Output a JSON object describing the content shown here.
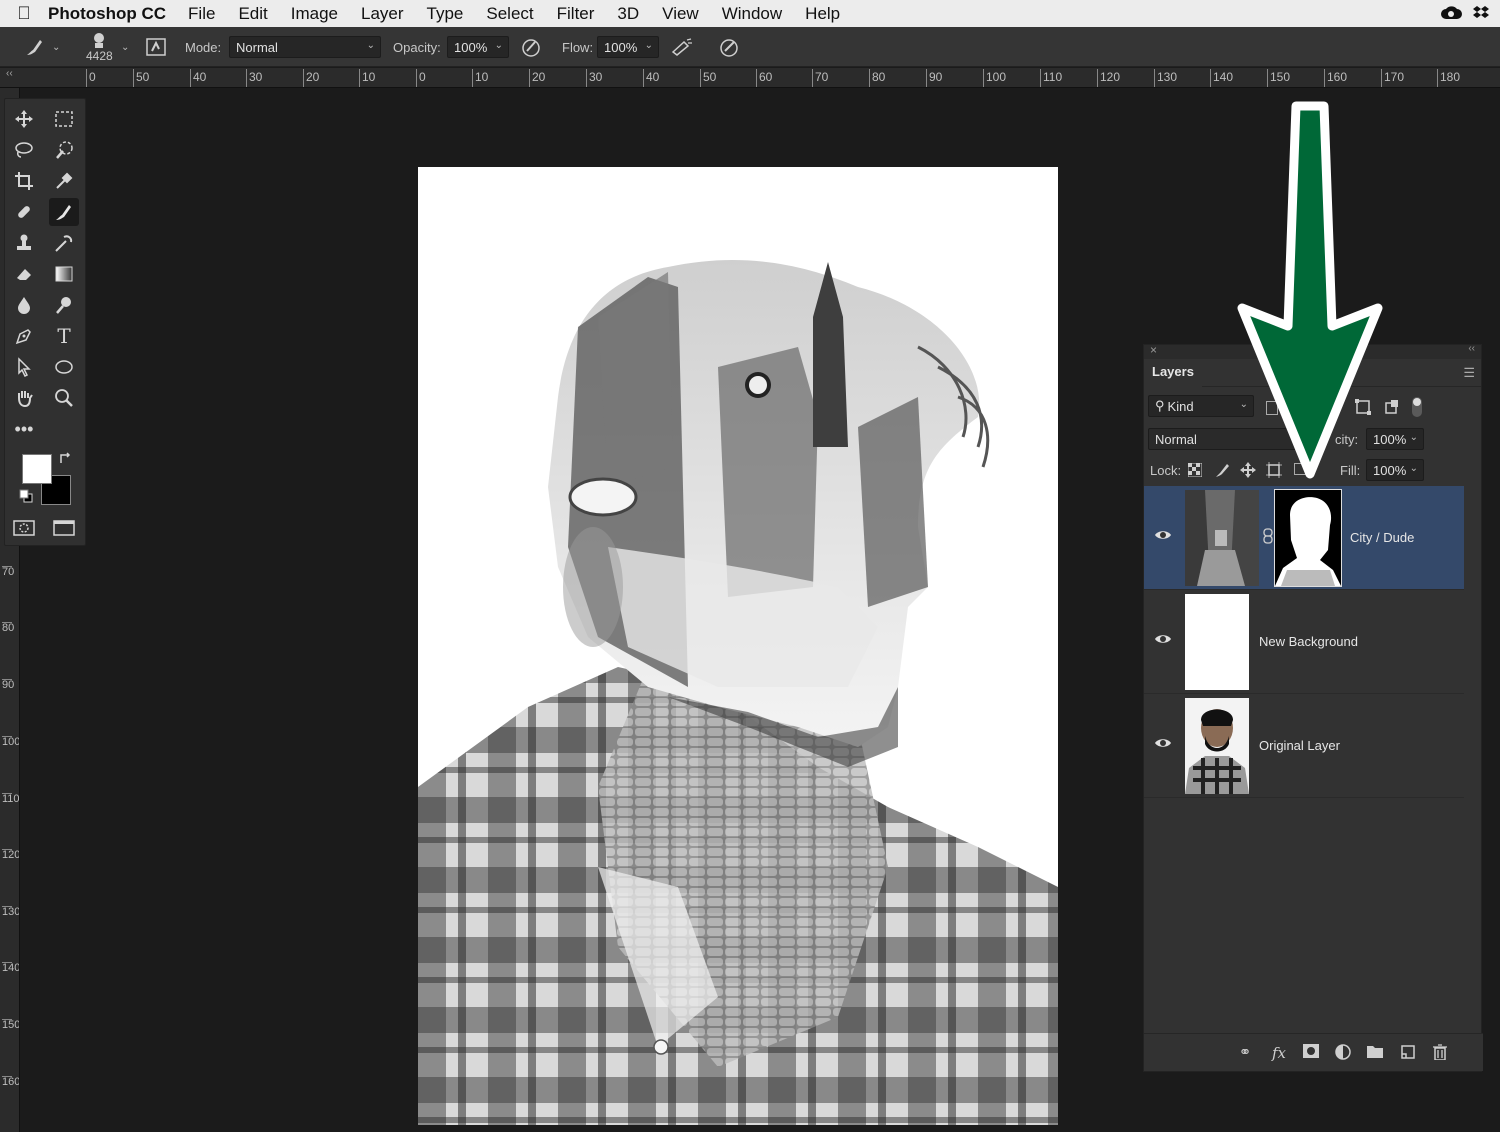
{
  "menubar": {
    "app_name": "Photoshop CC",
    "items": [
      "File",
      "Edit",
      "Image",
      "Layer",
      "Type",
      "Select",
      "Filter",
      "3D",
      "View",
      "Window",
      "Help"
    ]
  },
  "options_bar": {
    "brush_size": "4428",
    "mode_label": "Mode:",
    "mode_value": "Normal",
    "opacity_label": "Opacity:",
    "opacity_value": "100%",
    "flow_label": "Flow:",
    "flow_value": "100%"
  },
  "ruler": {
    "top_ticks": [
      "0",
      "50",
      "40",
      "30",
      "20",
      "10",
      "0",
      "10",
      "20",
      "30",
      "40",
      "50",
      "60",
      "70",
      "80",
      "90",
      "100",
      "110",
      "120",
      "130",
      "140",
      "150",
      "160",
      "170",
      "180"
    ],
    "left_ticks": [
      "70",
      "80",
      "90",
      "100",
      "110",
      "120",
      "130",
      "140",
      "150",
      "160"
    ]
  },
  "tools": {
    "colors": {
      "foreground": "#ffffff",
      "background": "#000000"
    }
  },
  "layers_panel": {
    "title": "Layers",
    "filter_label": "Kind",
    "blend_mode": "Normal",
    "opacity_label": "Opacity:",
    "opacity_shown": "city:",
    "opacity_value": "100%",
    "lock_label": "Lock:",
    "fill_label": "Fill:",
    "fill_value": "100%",
    "layers": [
      {
        "name": "City / Dude",
        "visible": true,
        "selected": true,
        "has_mask": true
      },
      {
        "name": "New Background",
        "visible": true,
        "selected": false,
        "has_mask": false
      },
      {
        "name": "Original Layer",
        "visible": true,
        "selected": false,
        "has_mask": false
      }
    ]
  },
  "annotation_arrow": {
    "color": "#006837",
    "outline": "#ffffff",
    "direction": "down"
  }
}
